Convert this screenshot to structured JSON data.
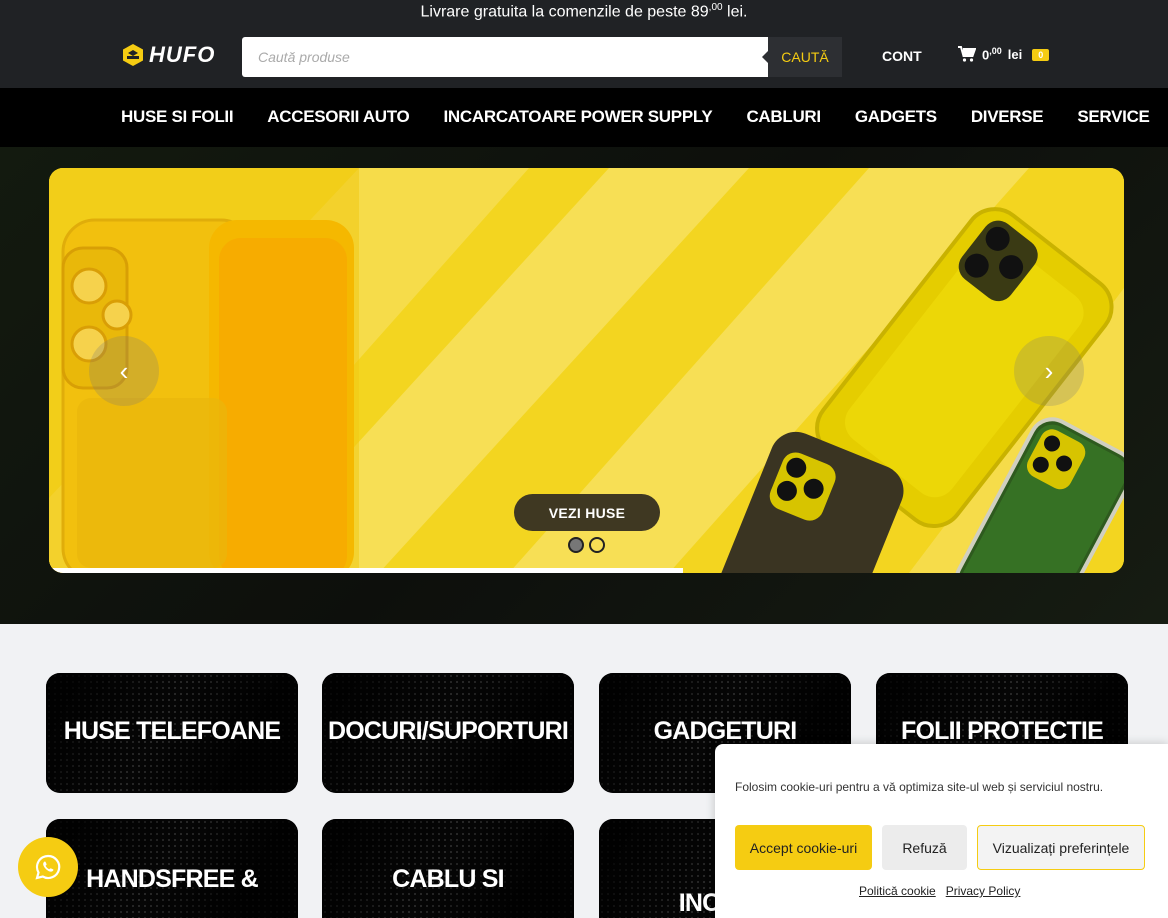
{
  "promo": {
    "text_before": "Livrare gratuita la comenzile de peste 89",
    "sup": ",00",
    "text_after": " lei."
  },
  "header": {
    "logo_text": "HUFO",
    "search_placeholder": "Caută produse",
    "search_button": "CAUTĂ",
    "account_label": "CONT",
    "cart_amount": "0",
    "cart_sup": ",00",
    "cart_currency": "lei",
    "cart_count": "0"
  },
  "nav": {
    "items": [
      "HUSE SI FOLII",
      "ACCESORII AUTO",
      "INCARCATOARE POWER SUPPLY",
      "CABLURI",
      "GADGETS",
      "DIVERSE",
      "SERVICE"
    ]
  },
  "hero": {
    "cta_label": "VEZI HUSE",
    "slide_count": 2,
    "active_slide": 1,
    "progress": 0.59
  },
  "categories": [
    "HUSE TELEFOANE",
    "DOCURI/SUPORTURI",
    "GADGETURI",
    "FOLII PROTECTIE",
    "HANDSFREE &",
    "CABLU SI",
    "INCARC"
  ],
  "cookie": {
    "message": "Folosim cookie-uri pentru a vă optimiza site-ul web și serviciul nostru.",
    "accept": "Accept cookie-uri",
    "refuse": "Refuză",
    "preferences": "Vizualizați preferințele",
    "policy_link": "Politică cookie",
    "privacy_link": "Privacy Policy"
  },
  "colors": {
    "accent": "#f5cc12",
    "dark": "#202225",
    "nav": "#000000"
  },
  "icons": {
    "cart": "cart-icon",
    "whatsapp": "whatsapp-icon",
    "prev": "chevron-left-icon",
    "next": "chevron-right-icon"
  }
}
